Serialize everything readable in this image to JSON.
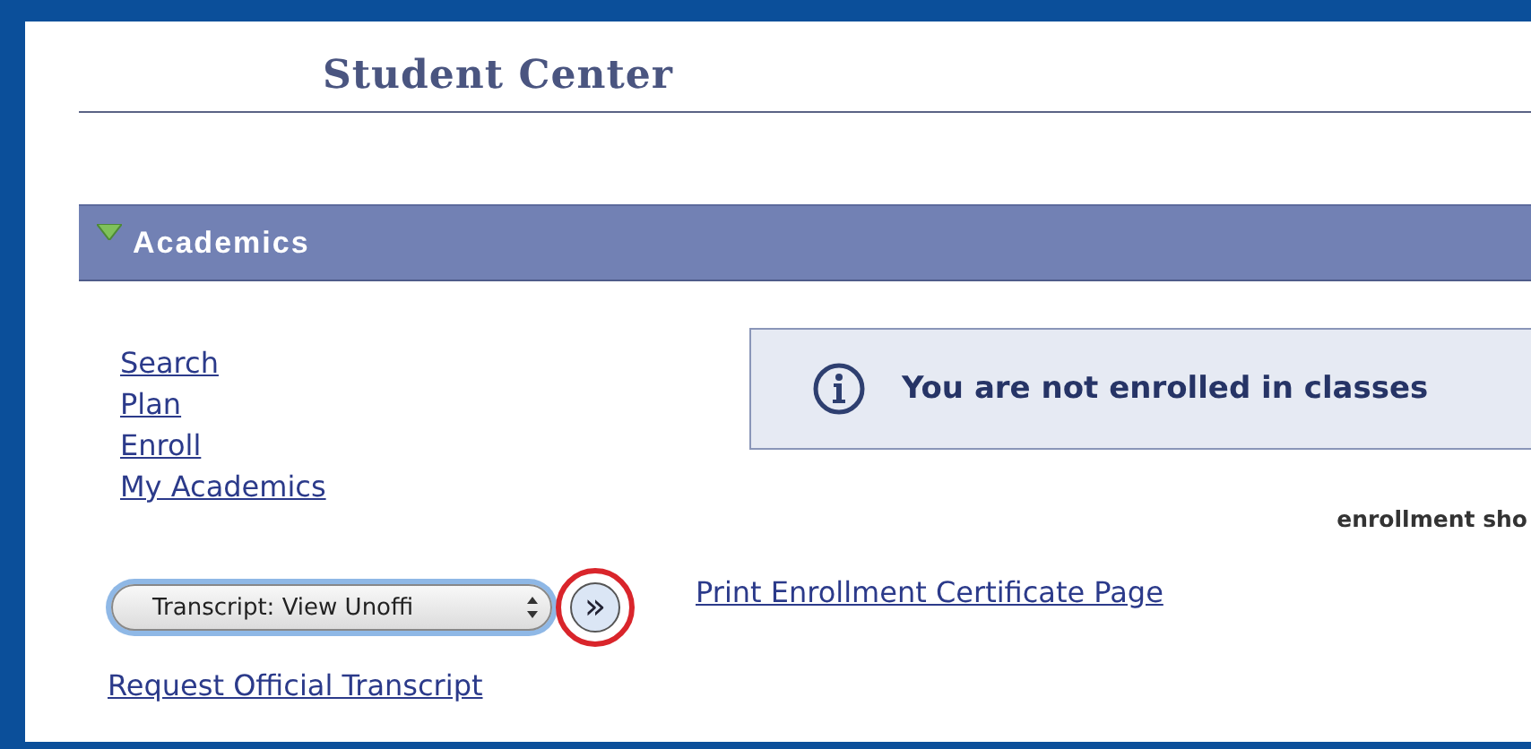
{
  "page_title": "Student Center",
  "section": {
    "title": "Academics",
    "expanded": true
  },
  "links": [
    {
      "label": "Search"
    },
    {
      "label": "Plan"
    },
    {
      "label": "Enroll"
    },
    {
      "label": "My Academics"
    }
  ],
  "notice": {
    "message": "You are not enrolled in classes"
  },
  "note": "enrollment sho",
  "transcript_select": {
    "value": "Transcript: View Unoffi"
  },
  "go_button": {
    "label": "»",
    "highlighted": true
  },
  "print_link": "Print Enrollment Certificate Page",
  "request_link": "Request Official Transcript"
}
